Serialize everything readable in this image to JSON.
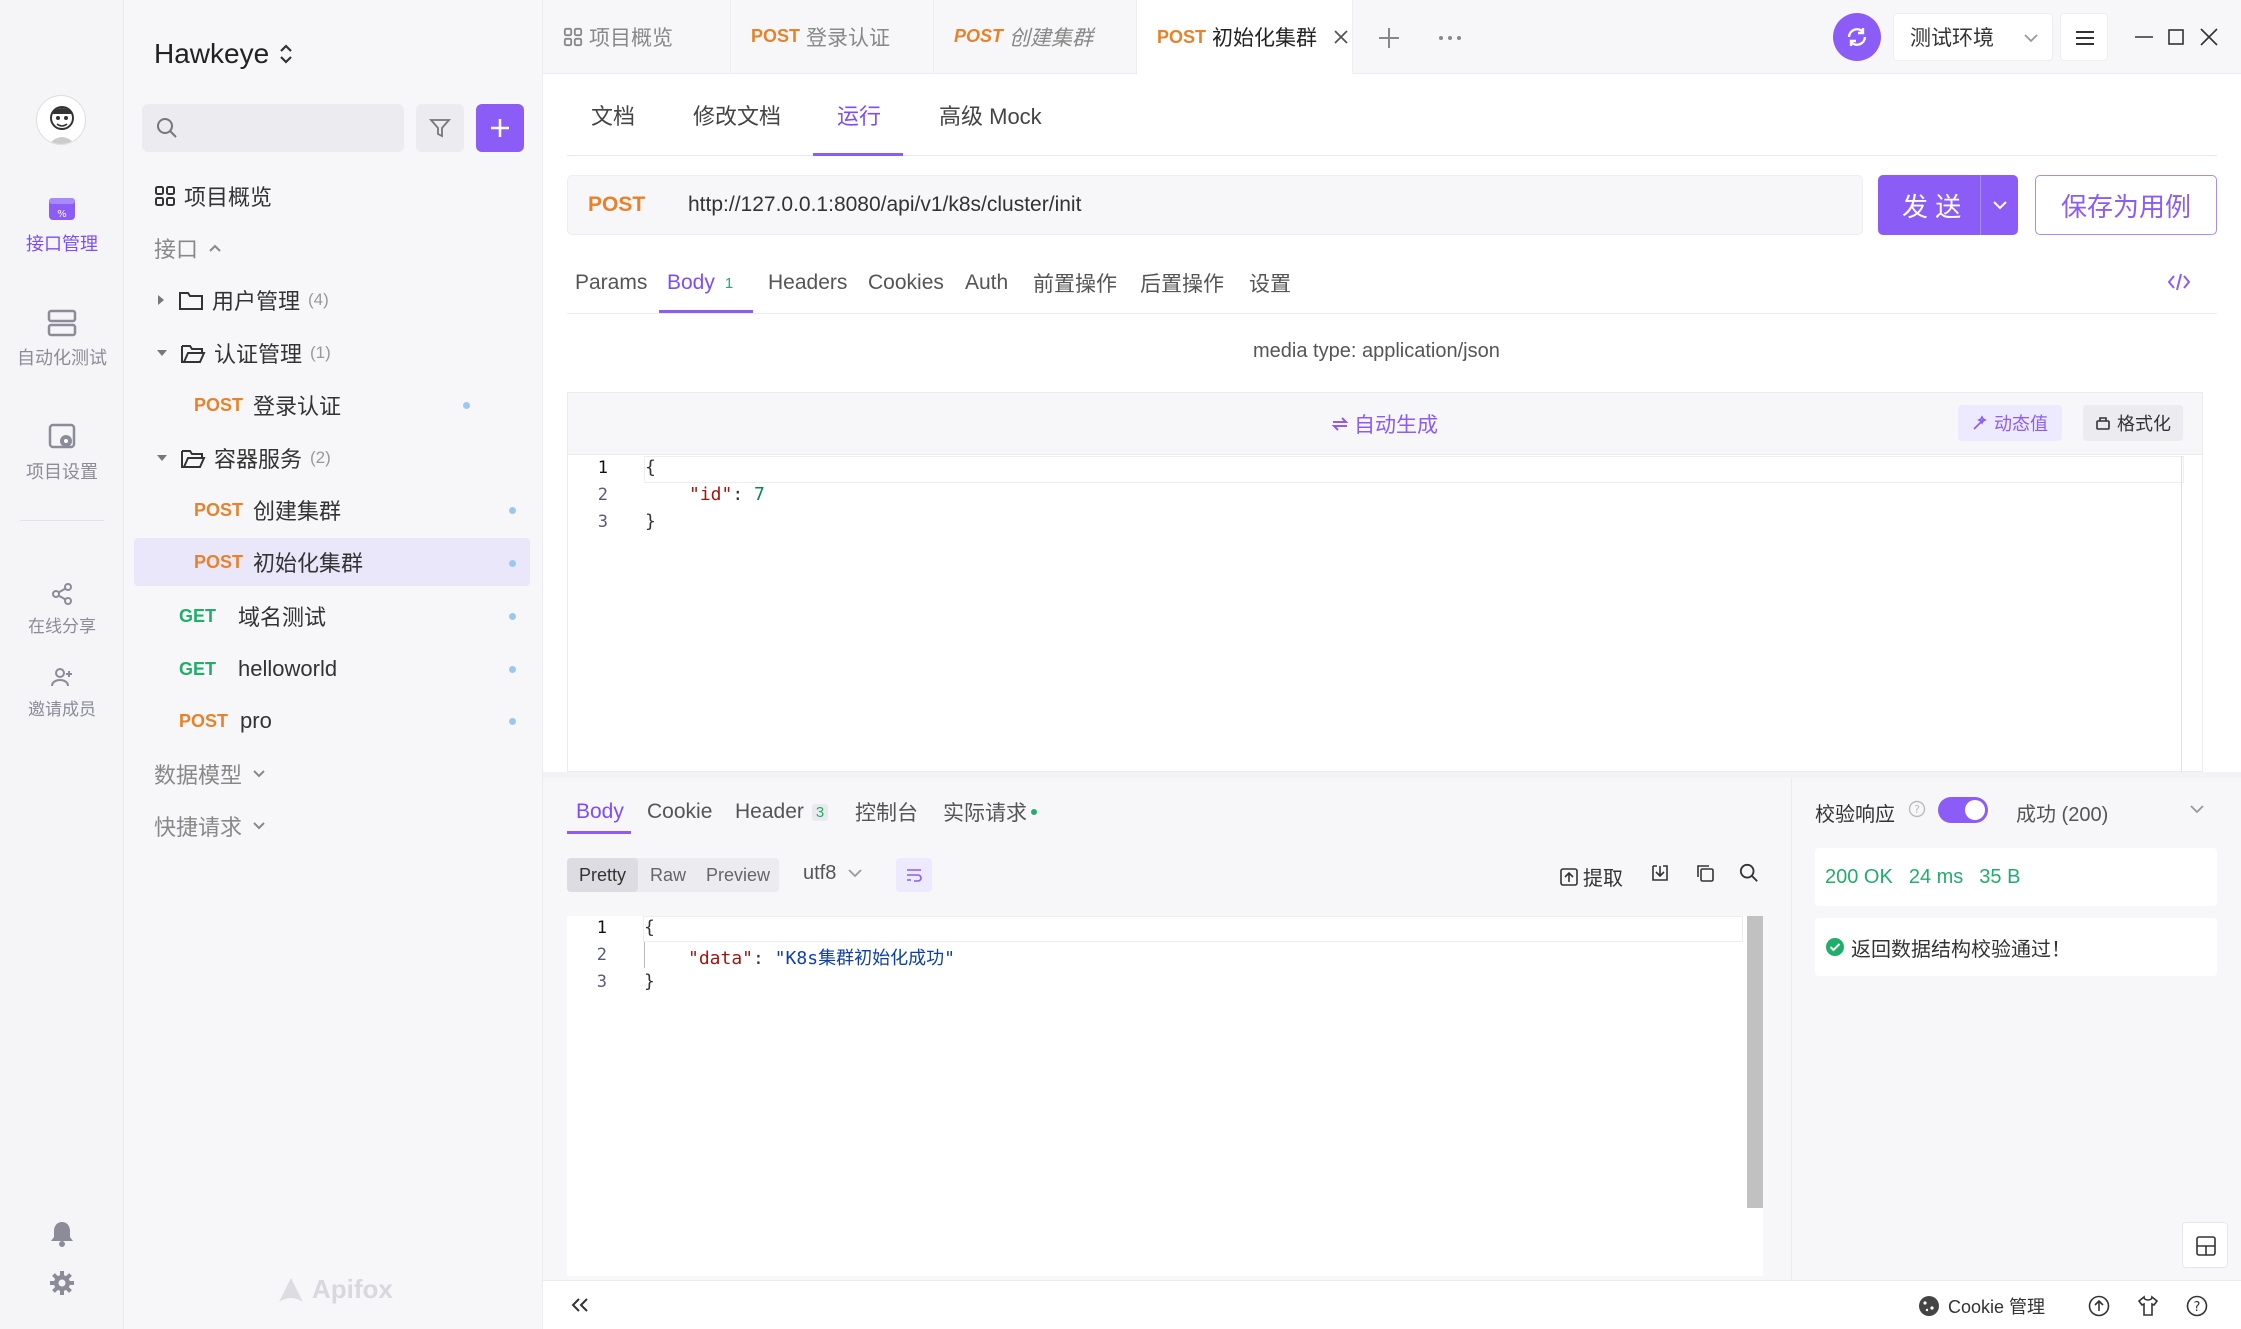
{
  "app": {
    "project": "Hawkeye",
    "watermark": "Apifox"
  },
  "rail": {
    "items": [
      {
        "label": "接口管理",
        "icon": "api-icon",
        "active": true
      },
      {
        "label": "自动化测试",
        "icon": "automation-icon"
      },
      {
        "label": "项目设置",
        "icon": "settings-doc-icon"
      },
      {
        "label": "在线分享",
        "icon": "share-icon"
      },
      {
        "label": "邀请成员",
        "icon": "invite-icon"
      }
    ]
  },
  "sidebar": {
    "overview": "项目概览",
    "section_api": "接口",
    "folders": [
      {
        "name": "用户管理",
        "count": "(4)"
      },
      {
        "name": "认证管理",
        "count": "(1)"
      },
      {
        "name": "容器服务",
        "count": "(2)"
      }
    ],
    "endpoints": [
      {
        "method": "POST",
        "name": "登录认证"
      },
      {
        "method": "POST",
        "name": "创建集群"
      },
      {
        "method": "POST",
        "name": "初始化集群"
      },
      {
        "method": "GET",
        "name": "域名测试"
      },
      {
        "method": "GET",
        "name": "helloworld"
      },
      {
        "method": "POST",
        "name": "pro"
      }
    ],
    "section_models": "数据模型",
    "section_quick": "快捷请求"
  },
  "tabs": [
    {
      "method": "",
      "label": "项目概览"
    },
    {
      "method": "POST",
      "label": "登录认证"
    },
    {
      "method": "POST",
      "label": "创建集群"
    },
    {
      "method": "POST",
      "label": "初始化集群"
    }
  ],
  "env": {
    "label": "测试环境"
  },
  "subtabs": [
    "文档",
    "修改文档",
    "运行",
    "高级 Mock"
  ],
  "request": {
    "method": "POST",
    "url": "http://127.0.0.1:8080/api/v1/k8s/cluster/init",
    "send": "发 送",
    "save": "保存为用例"
  },
  "req_tabs": [
    "Params",
    "Body",
    "Headers",
    "Cookies",
    "Auth",
    "前置操作",
    "后置操作",
    "设置"
  ],
  "req_body_badge": "1",
  "media_type": "media type: application/json",
  "auto_gen": "自动生成",
  "dynamic_value": "动态值",
  "format_btn": "格式化",
  "req_body": {
    "lines": [
      "1",
      "2",
      "3"
    ],
    "open": "{",
    "key": "\"id\"",
    "colon": ": ",
    "value": "7",
    "close": "}"
  },
  "resp_tabs": [
    "Body",
    "Cookie",
    "Header",
    "控制台",
    "实际请求"
  ],
  "resp_header_badge": "3",
  "view_modes": [
    "Pretty",
    "Raw",
    "Preview"
  ],
  "encoding": "utf8",
  "extract": "提取",
  "resp_body": {
    "lines": [
      "1",
      "2",
      "3"
    ],
    "open": "{",
    "key": "\"data\"",
    "colon": ": ",
    "value": "\"K8s集群初始化成功\"",
    "close": "}"
  },
  "validate": {
    "label": "校验响应",
    "result": "成功 (200)",
    "status": "200 OK",
    "time": "24 ms",
    "size": "35 B",
    "message": "返回数据结构校验通过！"
  },
  "footer": {
    "cookie": "Cookie 管理"
  }
}
